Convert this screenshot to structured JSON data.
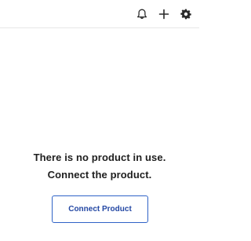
{
  "toolbar": {
    "icons": [
      "bell-icon",
      "plus-icon",
      "gear-icon"
    ]
  },
  "empty_state": {
    "line1": "There is no product in use.",
    "line2": "Connect the product.",
    "button_label": "Connect Product"
  },
  "colors": {
    "text": "#202020",
    "accent_border": "#2f63c7",
    "accent_text": "#2347a3",
    "divider": "#e6e6e6"
  }
}
